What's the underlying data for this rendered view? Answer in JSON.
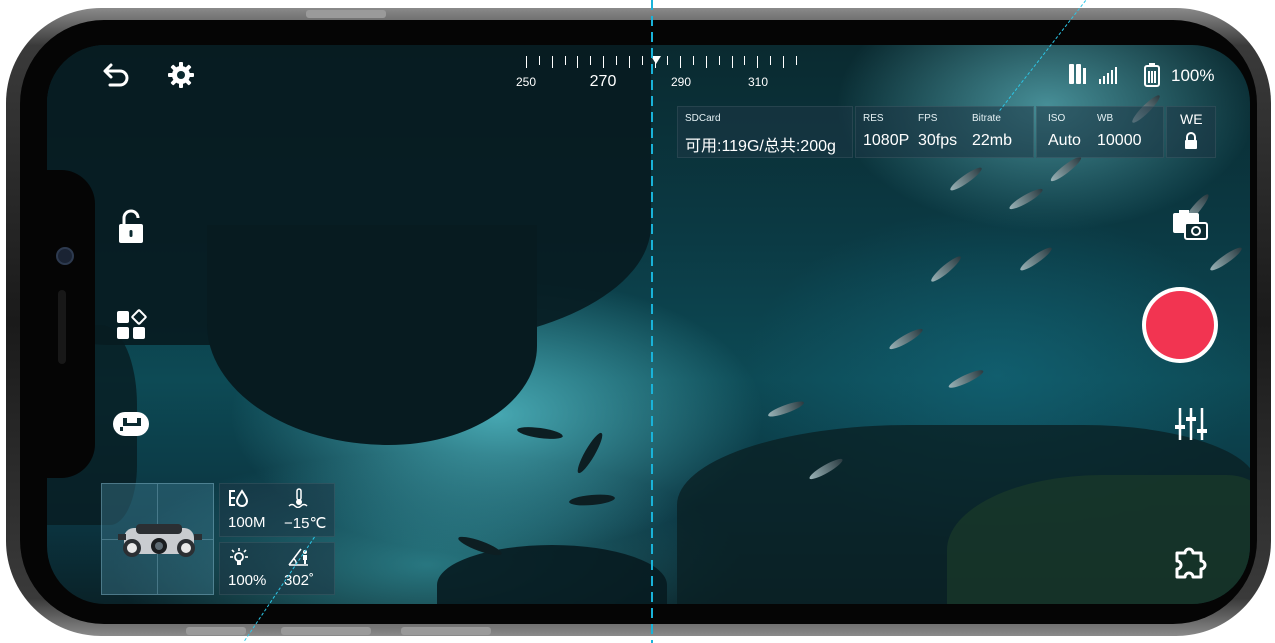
{
  "compass": {
    "labels": [
      "250",
      "270",
      "290",
      "310"
    ]
  },
  "status": {
    "battery": "100%"
  },
  "sd_card": {
    "label": "SDCard",
    "value": "可用:119G/总共:200g"
  },
  "video": {
    "res_label": "RES",
    "res_value": "1080P",
    "fps_label": "FPS",
    "fps_value": "30fps",
    "bitrate_label": "Bitrate",
    "bitrate_value": "22mb"
  },
  "exposure": {
    "iso_label": "ISO",
    "iso_value": "Auto",
    "wb_label": "WB",
    "wb_value": "10000"
  },
  "we_lock": {
    "label": "WE"
  },
  "telemetry": {
    "depth": "100M",
    "temperature": "−15℃",
    "light": "100%",
    "heading": "302˚"
  },
  "colors": {
    "accent": "#19b3d9",
    "record": "#f23451",
    "panel": "rgba(30,55,70,0.55)"
  },
  "icons": [
    "back-icon",
    "settings-icon",
    "lock-open-icon",
    "apps-icon",
    "drone-icon",
    "signal-icon",
    "battery-icon",
    "camera-switch-icon",
    "record-button",
    "sliders-icon",
    "plugin-icon",
    "lock-icon",
    "depth-icon",
    "temperature-icon",
    "light-icon",
    "heading-icon"
  ]
}
